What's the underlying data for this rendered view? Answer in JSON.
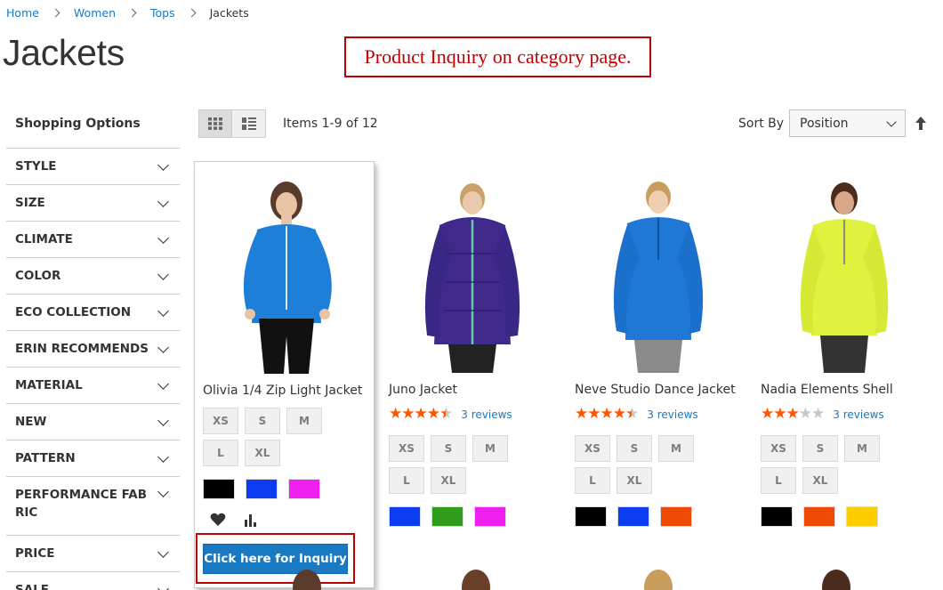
{
  "breadcrumb": {
    "home": "Home",
    "women": "Women",
    "tops": "Tops",
    "current": "Jackets"
  },
  "page_title": "Jackets",
  "callout": "Product Inquiry on category page.",
  "sidebar": {
    "title": "Shopping Options",
    "filters": [
      "STYLE",
      "SIZE",
      "CLIMATE",
      "COLOR",
      "ECO COLLECTION",
      "ERIN RECOMMENDS",
      "MATERIAL",
      "NEW",
      "PATTERN",
      "PERFORMANCE FABRIC",
      "PRICE",
      "SALE"
    ]
  },
  "toolbar": {
    "items_count": "Items 1-9 of 12",
    "sort_label": "Sort By",
    "sort_value": "Position"
  },
  "products": [
    {
      "name": "Olivia 1/4 Zip Light Jacket",
      "sizes": [
        "XS",
        "S",
        "M",
        "L",
        "XL"
      ],
      "colors": [
        "#000000",
        "#0a3cf0",
        "#ef1ff0"
      ],
      "inquiry_label": "Click here for Inquiry"
    },
    {
      "name": "Juno Jacket",
      "rating": 4.5,
      "reviews": "3 reviews",
      "sizes": [
        "XS",
        "S",
        "M",
        "L",
        "XL"
      ],
      "colors": [
        "#0a3cf0",
        "#2f9c1b",
        "#ef1ff0"
      ]
    },
    {
      "name": "Neve Studio Dance Jacket",
      "rating": 4.5,
      "reviews": "3 reviews",
      "sizes": [
        "XS",
        "S",
        "M",
        "L",
        "XL"
      ],
      "colors": [
        "#000000",
        "#0a3cf0",
        "#ee4a06"
      ]
    },
    {
      "name": "Nadia Elements Shell",
      "rating": 3,
      "reviews": "3 reviews",
      "sizes": [
        "XS",
        "S",
        "M",
        "L",
        "XL"
      ],
      "colors": [
        "#000000",
        "#ee4a06",
        "#ffcc00"
      ]
    }
  ]
}
